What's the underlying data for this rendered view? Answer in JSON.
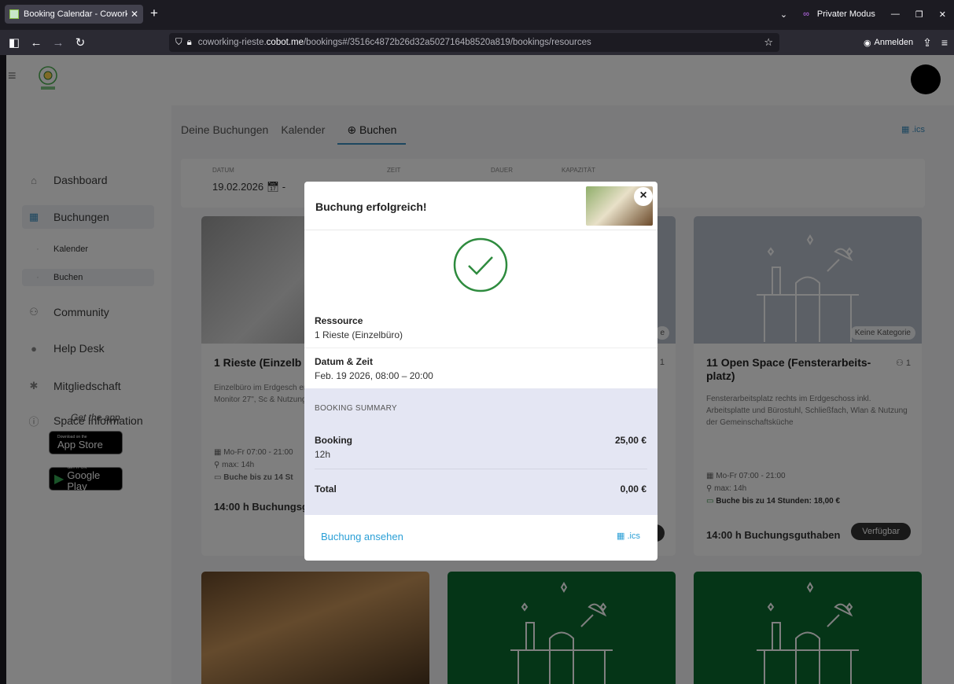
{
  "browser": {
    "tab_title": "Booking Calendar - Coworking",
    "new_tab_icon": "+",
    "private_mode_label": "Privater Modus",
    "url_prefix": "coworking-rieste.",
    "url_domain": "cobot.me",
    "url_path": "/bookings#/3516c4872b26d32a5027164b8520a819/bookings/resources",
    "signin_label": "Anmelden"
  },
  "sidebar": {
    "items": [
      {
        "icon": "home-icon",
        "label": "Dashboard"
      },
      {
        "icon": "calendar-icon",
        "label": "Buchungen"
      },
      {
        "icon": "users-icon",
        "label": "Community"
      },
      {
        "icon": "chat-icon",
        "label": "Help Desk"
      },
      {
        "icon": "gear-icon",
        "label": "Mitgliedschaft"
      },
      {
        "icon": "info-icon",
        "label": "Space Information"
      }
    ],
    "subitems": [
      "Kalender",
      "Buchen"
    ],
    "get_app": "Get the app",
    "app_store": {
      "small": "Download on the",
      "big": "App Store"
    },
    "google_play": {
      "small": "GET IT ON",
      "big": "Google Play"
    }
  },
  "content": {
    "tabs": [
      "Deine Buchungen",
      "Kalender",
      "Buchen"
    ],
    "ics_label": ".ics",
    "filters": {
      "datum_label": "Datum",
      "datum_value": "19.02.2026",
      "zeit_label": "Zeit",
      "dauer_label": "Dauer",
      "kapazitaet_label": "Kapazität"
    },
    "cards": [
      {
        "title": "1 Rieste (Einzelb",
        "desc": "Einzelbüro im Erdgesch ergonomischen Schreib rostuhl, Monitor 27\", Sc & Nutzung der Gemeins",
        "hours": "Mo-Fr 07:00 - 21:00",
        "max": "max: 14h",
        "price": "Buche bis zu 14 St",
        "footer": "14:00 h Buchungsg"
      },
      {
        "title": "11 Open Space (Fensterarbeits-platz)",
        "capacity": "1",
        "category": "Keine Kategorie",
        "desc": "Fensterarbeitsplatz rechts im Erdgeschoss inkl. Arbeitsplatte und Bürostuhl, Schließfach, Wlan & Nutzung der Gemeinschaftsküche",
        "hours": "Mo-Fr 07:00 - 21:00",
        "max": "max: 14h",
        "price": "Buche bis zu 14 Stunden: 18,00 €",
        "footer": "14:00 h Buchungsguthaben",
        "button": "Verfügbar"
      }
    ],
    "middle_card_badge": "e",
    "middle_card_cap": "1"
  },
  "modal": {
    "title": "Buchung erfolgreich!",
    "close_icon": "×",
    "resource_label": "Ressource",
    "resource_value": "1 Rieste (Einzelbüro)",
    "datetime_label": "Datum & Zeit",
    "datetime_value": "Feb. 19 2026, 08:00 – 20:00",
    "summary_header": "BOOKING SUMMARY",
    "booking_label": "Booking",
    "booking_sub": "12h",
    "booking_price": "25,00 €",
    "total_label": "Total",
    "total_price": "0,00 €",
    "view_link": "Buchung ansehen",
    "ics_label": ".ics"
  },
  "colors": {
    "accent": "#2a9fd6",
    "success": "#2e8b3e",
    "card_green": "#0b6b2e",
    "summary_bg": "#e4e6f3"
  }
}
